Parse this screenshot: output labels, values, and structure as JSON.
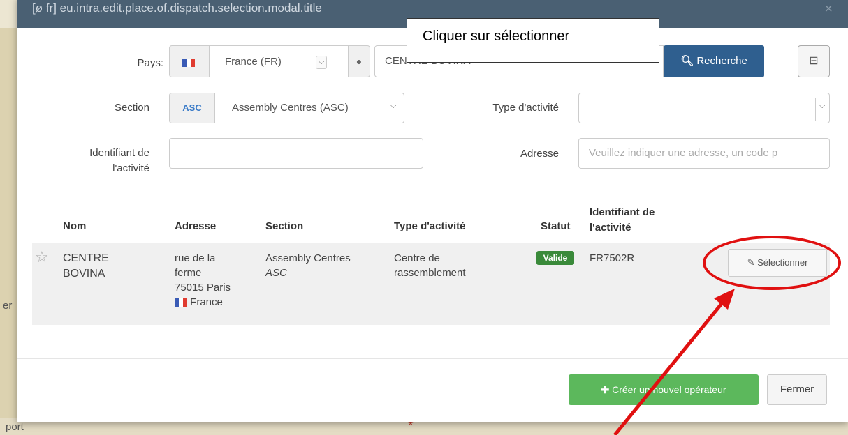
{
  "modal": {
    "title": "[ø fr] eu.intra.edit.place.of.dispatch.selection.modal.title",
    "close": "×"
  },
  "callout": {
    "text": "Cliquer sur sélectionner"
  },
  "form": {
    "country_label": "Pays:",
    "country_value": "France (FR)",
    "search_value": "CENTRE BOVINA",
    "search_button": "Recherche",
    "section_label": "Section",
    "section_code": "ASC",
    "section_value": "Assembly Centres (ASC)",
    "activity_type_label": "Type d'activité",
    "activity_id_label_line1": "Identifiant de",
    "activity_id_label_line2": "l'activité",
    "address_label": "Adresse",
    "address_placeholder": "Veuillez indiquer une adresse, un code p"
  },
  "table": {
    "headers": {
      "name": "Nom",
      "address": "Adresse",
      "section": "Section",
      "activity_type": "Type d'activité",
      "status": "Statut",
      "activity_id_line1": "Identifiant de",
      "activity_id_line2": "l'activité"
    },
    "row": {
      "star": "☆",
      "name_line1": "CENTRE",
      "name_line2": "BOVINA",
      "address_line1": "rue de la",
      "address_line2": "ferme",
      "address_line3": "75015 Paris",
      "address_country": "France",
      "section_line1": "Assembly Centres",
      "section_line2": "ASC",
      "activity_line1": "Centre de",
      "activity_line2": "rassemblement",
      "status": "Valide",
      "activity_id": "FR7502R",
      "select_button": "Sélectionner"
    }
  },
  "footer": {
    "create_button": "Créer un nouvel opérateur",
    "close_button": "Fermer"
  },
  "background": {
    "left_text": "er",
    "bottom_text": "port",
    "asterisk": "*"
  },
  "colors": {
    "header": "#4a6073",
    "primary": "#2f5f8f",
    "success": "#5cb85c",
    "status_valid": "#3a8a3a",
    "annotation_red": "#e01010"
  }
}
